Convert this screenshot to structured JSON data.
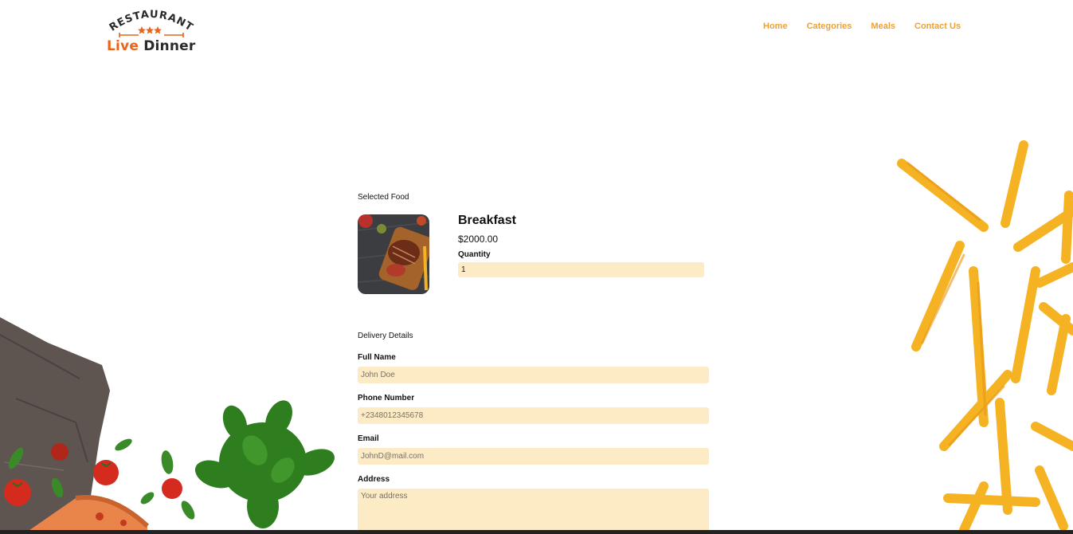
{
  "header": {
    "logo": {
      "arc_text": "RESTAURANT",
      "word_live": "Live",
      "word_dinner": "Dinner"
    },
    "nav": [
      {
        "label": "Home"
      },
      {
        "label": "Categories"
      },
      {
        "label": "Meals"
      },
      {
        "label": "Contact Us"
      }
    ]
  },
  "order": {
    "section_title": "Selected Food",
    "food_name": "Breakfast",
    "price": "$2000.00",
    "quantity_label": "Quantity",
    "quantity_value": "1"
  },
  "delivery": {
    "section_title": "Delivery Details",
    "full_name_label": "Full Name",
    "full_name_placeholder": "John Doe",
    "phone_label": "Phone Number",
    "phone_placeholder": "+2348012345678",
    "email_label": "Email",
    "email_placeholder": "JohnD@mail.com",
    "address_label": "Address",
    "address_placeholder": "Your address"
  },
  "colors": {
    "accent": "#f0a030",
    "brand_orange": "#e8651a",
    "input_bg": "#fdebc6"
  }
}
